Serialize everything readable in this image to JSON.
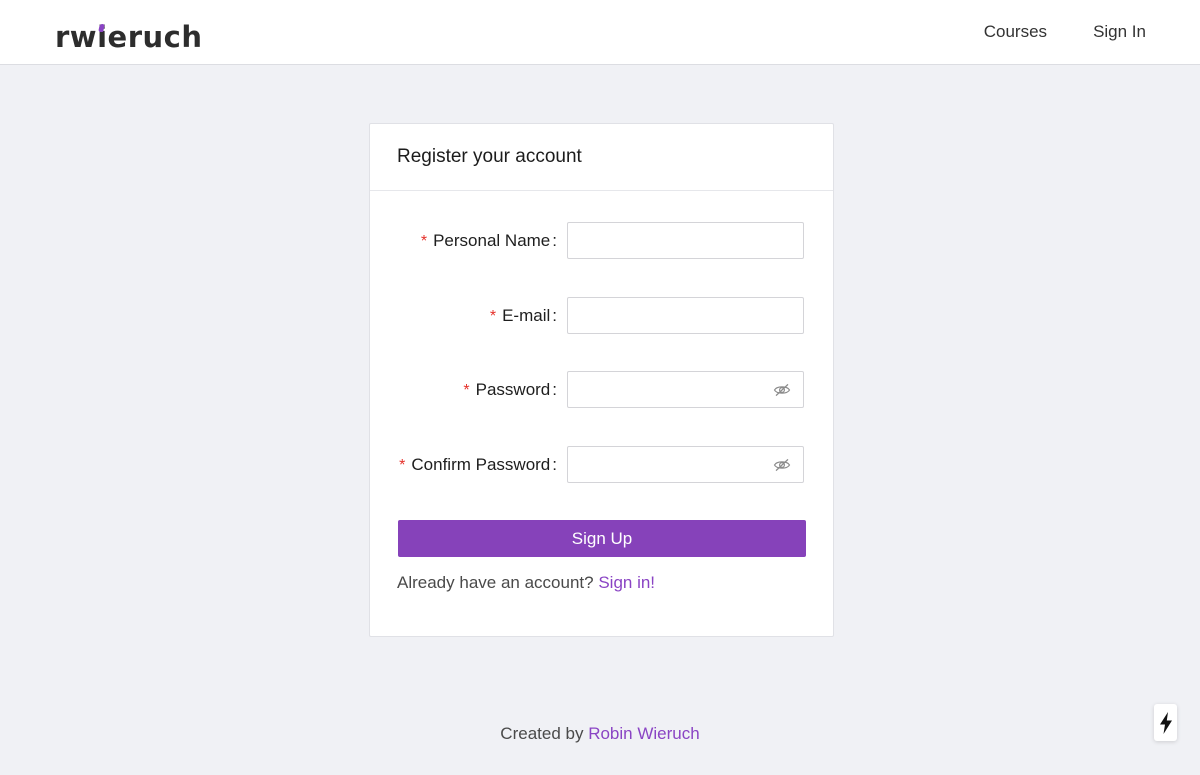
{
  "header": {
    "logo": {
      "prefix": "rw",
      "i": "i",
      "suffix": "eruch"
    },
    "nav": {
      "courses": "Courses",
      "sign_in": "Sign In"
    }
  },
  "form": {
    "title": "Register your account",
    "required_mark": "*",
    "colon": ":",
    "fields": [
      {
        "label": "Personal Name",
        "value": "",
        "type": "text"
      },
      {
        "label": "E-mail",
        "value": "",
        "type": "email"
      },
      {
        "label": "Password",
        "value": "",
        "type": "password",
        "icon": "eye-invisible-icon"
      },
      {
        "label": "Confirm Password",
        "value": "",
        "type": "password",
        "icon": "eye-invisible-icon"
      }
    ],
    "submit_label": "Sign Up",
    "signin_prompt": "Already have an account?",
    "signin_link": "Sign in!"
  },
  "footer": {
    "created_by": "Created by",
    "author": "Robin Wieruch"
  },
  "floating": {
    "icon": "lightning-bolt-icon"
  },
  "colors": {
    "accent": "#8642ba",
    "link": "#8a44c4",
    "required": "#e5312b",
    "background": "#f0f1f5"
  }
}
